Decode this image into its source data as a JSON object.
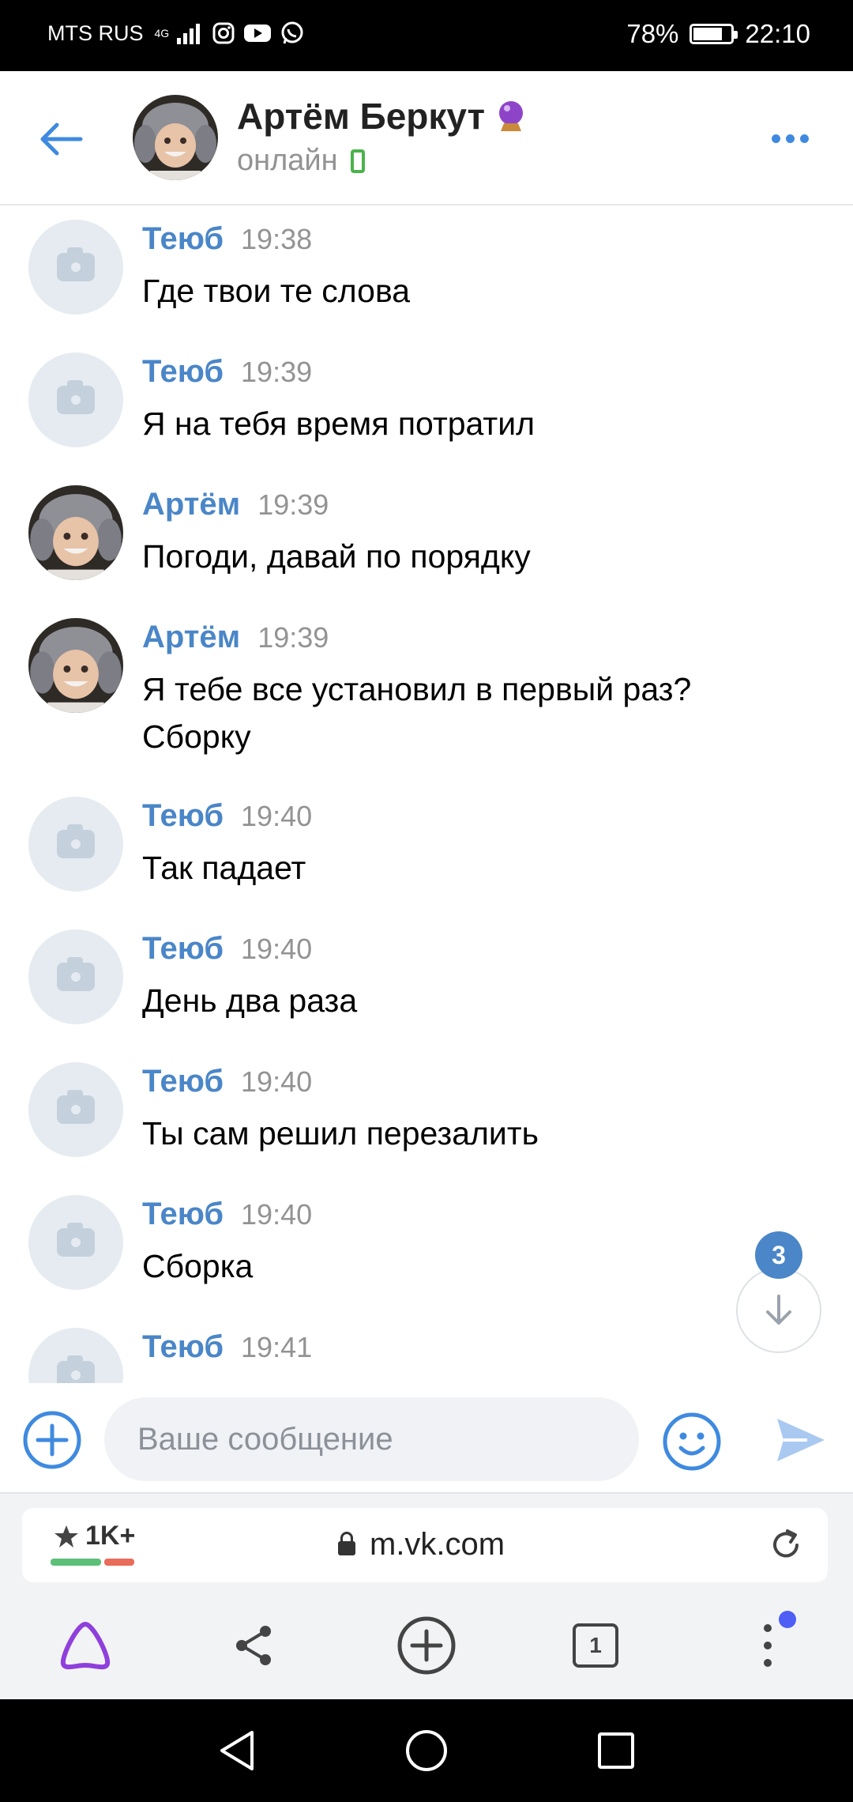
{
  "status_bar": {
    "carrier": "MTS RUS",
    "network": "4G",
    "battery": "78%",
    "time": "22:10"
  },
  "header": {
    "name": "Артём Беркут",
    "status": "онлайн"
  },
  "messages": [
    {
      "author": "Теюб",
      "time": "19:38",
      "text": "Где твои те слова"
    },
    {
      "author": "Теюб",
      "time": "19:39",
      "text": "Я на тебя время потратил"
    },
    {
      "author": "Артём",
      "time": "19:39",
      "text": "Погоди, давай по порядку"
    },
    {
      "author": "Артём",
      "time": "19:39",
      "text_lines": [
        "Я тебе все установил в первый раз?",
        "Сборку"
      ]
    },
    {
      "author": "Теюб",
      "time": "19:40",
      "text": "Так падает"
    },
    {
      "author": "Теюб",
      "time": "19:40",
      "text": "День два раза"
    },
    {
      "author": "Теюб",
      "time": "19:40",
      "text": "Ты сам решил перезалить"
    },
    {
      "author": "Теюб",
      "time": "19:40",
      "text": "Сборка"
    },
    {
      "author": "Теюб",
      "time": "19:41",
      "text": ""
    }
  ],
  "unread_badge": "3",
  "composer": {
    "placeholder": "Ваше сообщение"
  },
  "browser": {
    "rating": "1K+",
    "url": "m.vk.com",
    "tabs_count": "1"
  },
  "colors": {
    "accent": "#3f8ae0",
    "author": "#4a86c8",
    "alice": "#8f3fdc",
    "online": "#4bb34b"
  }
}
